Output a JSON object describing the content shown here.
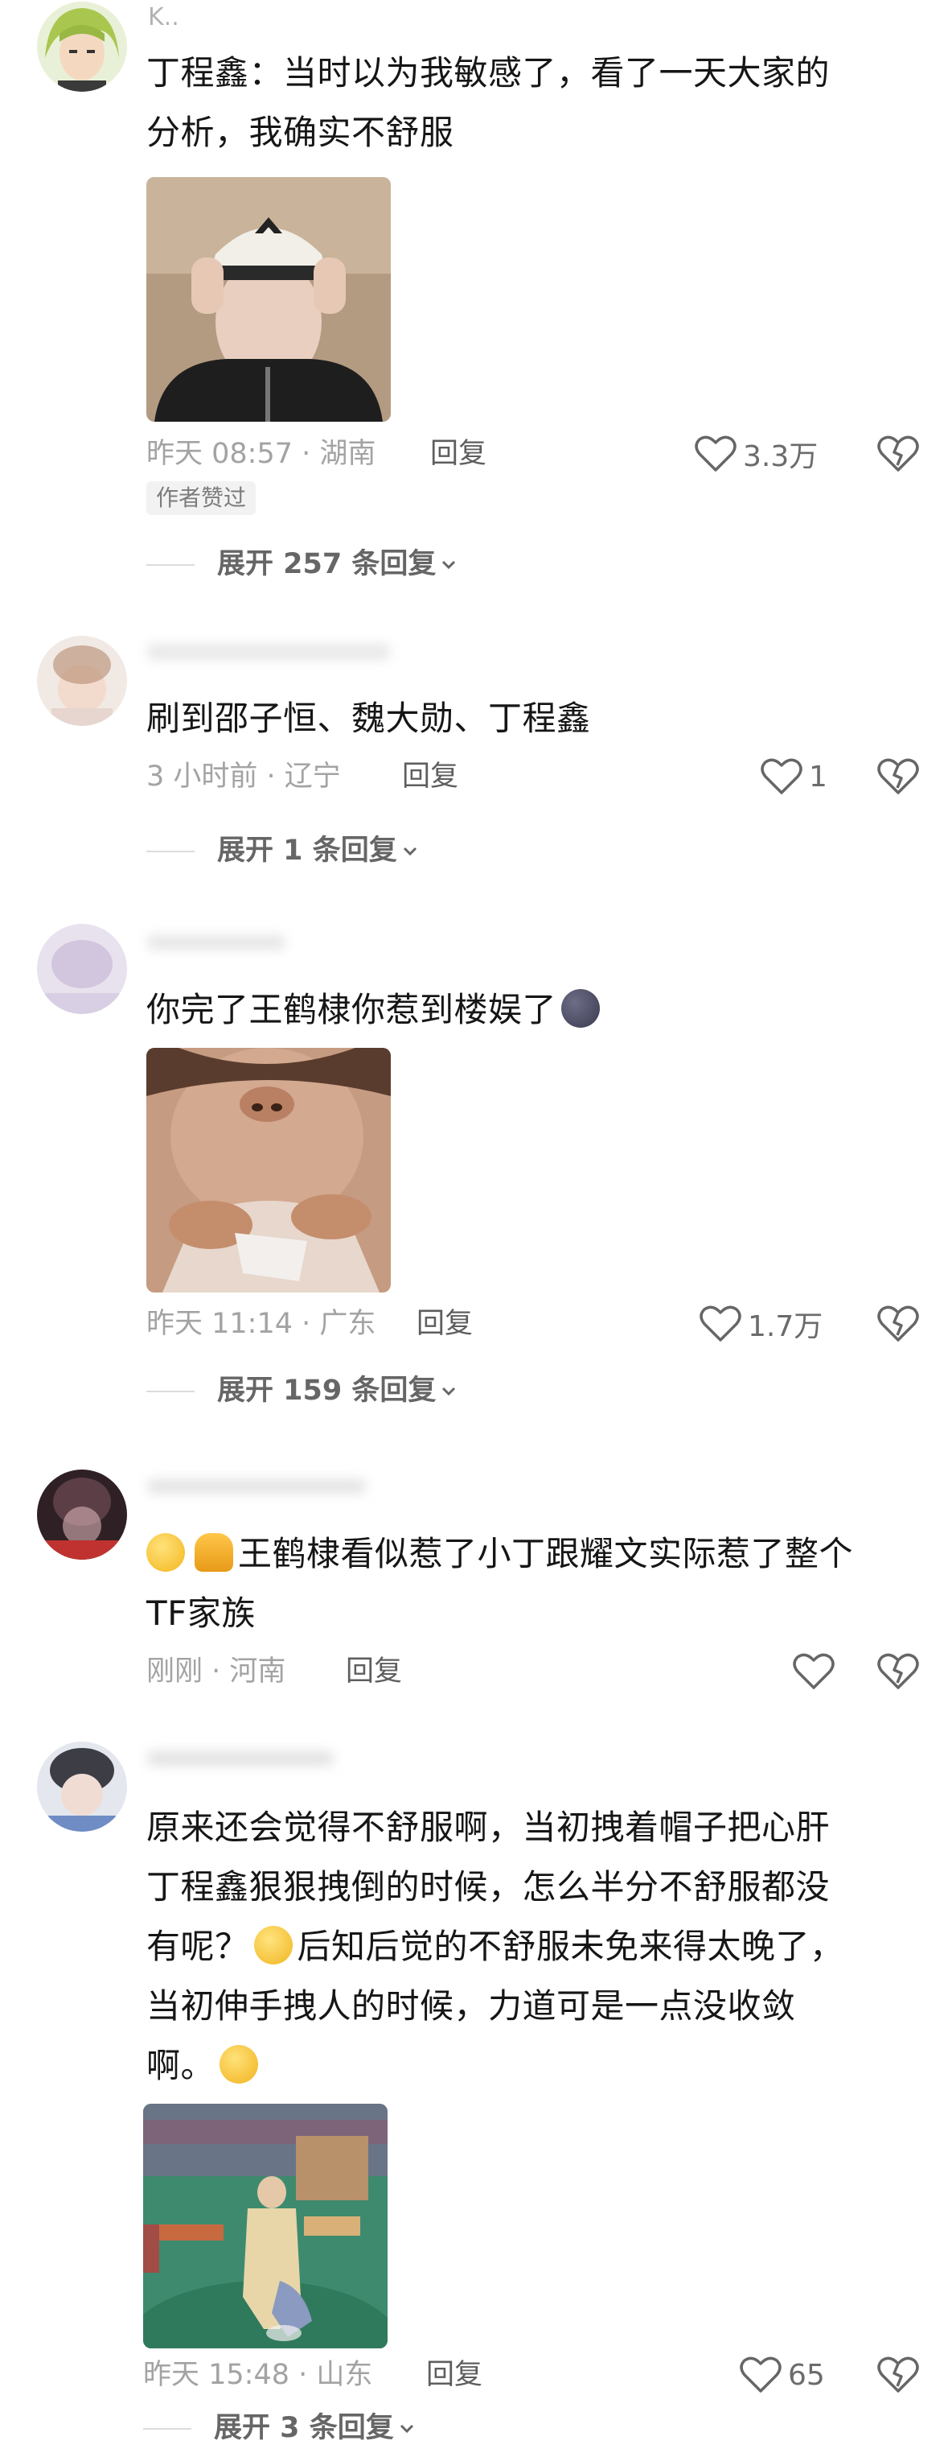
{
  "comments": [
    {
      "username": "K..",
      "text_lines": [
        "丁程鑫：当时以为我敏感了，看了一天大家的",
        "分析，我确实不舒服"
      ],
      "time": "昨天 08:57 · 湖南",
      "reply_label": "回复",
      "likes": "3.3万",
      "badge": "作者赞过",
      "expand": "展开 257 条回复"
    },
    {
      "username": "",
      "text_lines": [
        "刷到邵子恒、魏大勋、丁程鑫"
      ],
      "time": "3 小时前 · 辽宁",
      "reply_label": "回复",
      "likes": "1",
      "expand": "展开 1 条回复"
    },
    {
      "username": "",
      "text_line1": "你完了王鹤棣你惹到楼娱了",
      "time": "昨天 11:14 · 广东",
      "reply_label": "回复",
      "likes": "1.7万",
      "expand": "展开 159 条回复"
    },
    {
      "username": "",
      "text_line1": "王鹤棣看似惹了小丁跟耀文实际惹了整个",
      "text_line2": "TF家族",
      "time": "刚刚 · 河南",
      "reply_label": "回复",
      "likes": ""
    },
    {
      "username": "",
      "line1": "原来还会觉得不舒服啊，当初拽着帽子把心肝",
      "line2": "丁程鑫狠狠拽倒的时候，怎么半分不舒服都没",
      "line3_a": "有呢？",
      "line3_b": "后知后觉的不舒服未免来得太晚了，",
      "line4": "当初伸手拽人的时候，力道可是一点没收敛",
      "line5": "啊。",
      "time": "昨天 15:48 · 山东",
      "reply_label": "回复",
      "likes": "65",
      "expand": "展开 3 条回复"
    }
  ],
  "icons": {
    "like": "heart-outline-icon",
    "dislike": "broken-heart-icon",
    "expand": "chevron-down-icon"
  },
  "colors": {
    "text": "#161616",
    "meta": "#a3a3a3",
    "reply": "#5e5e5e"
  }
}
